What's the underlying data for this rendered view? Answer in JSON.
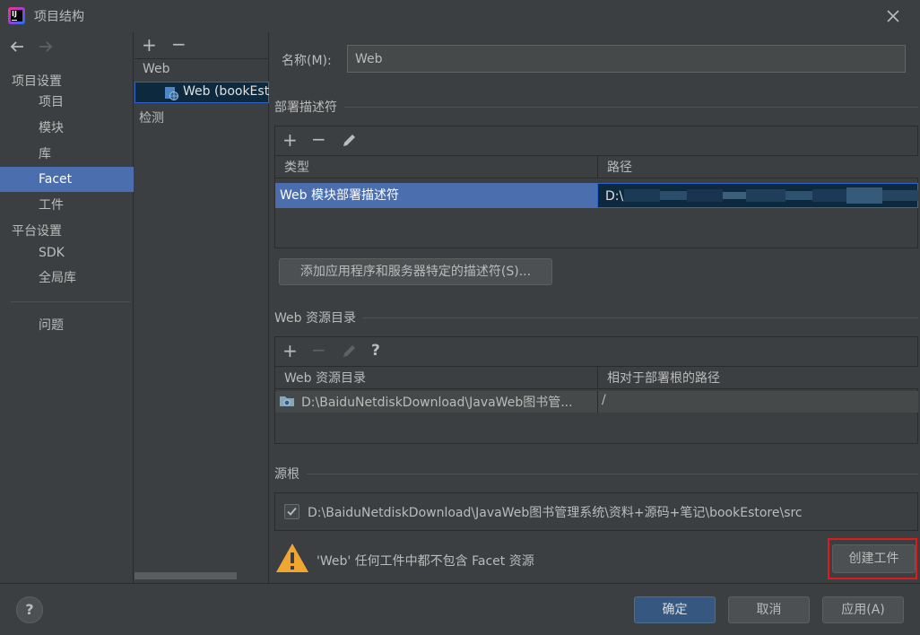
{
  "window": {
    "title": "项目结构"
  },
  "nav": {
    "section_project": "项目设置",
    "project_items": [
      {
        "label": "项目"
      },
      {
        "label": "模块"
      },
      {
        "label": "库"
      },
      {
        "label": "Facet"
      },
      {
        "label": "工件"
      }
    ],
    "section_platform": "平台设置",
    "platform_items": [
      {
        "label": "SDK"
      },
      {
        "label": "全局库"
      }
    ],
    "problems": "问题"
  },
  "facet_tree": {
    "group": "Web",
    "selected_facet": "Web (bookEstore)",
    "detect": "检测"
  },
  "facet_name": {
    "label": "名称(M):",
    "value": "Web"
  },
  "deployment_descriptors": {
    "title": "部署描述符",
    "columns": [
      "类型",
      "路径"
    ],
    "rows": [
      {
        "type": "Web 模块部署描述符",
        "path": "D:\\"
      }
    ],
    "add_button": "添加应用程序和服务器特定的描述符(S)..."
  },
  "web_resource_dirs": {
    "title": "Web 资源目录",
    "columns": [
      "Web 资源目录",
      "相对于部署根的路径"
    ],
    "rows": [
      {
        "dir": "D:\\BaiduNetdiskDownload\\JavaWeb图书管...",
        "relative": "/"
      }
    ]
  },
  "source_roots": {
    "title": "源根",
    "items": [
      {
        "checked": true,
        "path": "D:\\BaiduNetdiskDownload\\JavaWeb图书管理系统\\资料+源码+笔记\\bookEstore\\src"
      }
    ]
  },
  "warning": {
    "text": "'Web' 任何工件中都不包含 Facet 资源",
    "action": "创建工件"
  },
  "footer": {
    "help": "?",
    "ok": "确定",
    "cancel": "取消",
    "apply": "应用(A)"
  },
  "colors": {
    "selection": "#4b6eaf",
    "primary_button": "#365880",
    "highlight_box": "#e01a1a",
    "warning": "#f0a732"
  }
}
